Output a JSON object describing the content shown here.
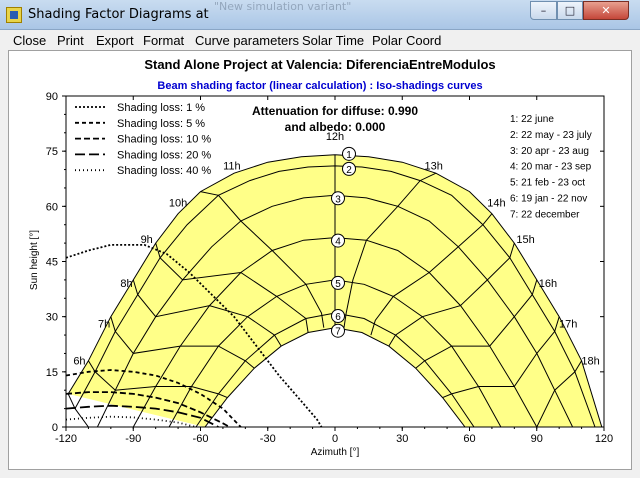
{
  "window": {
    "title": "Shading Factor Diagrams at",
    "background_title": "\"New simulation variant\"",
    "buttons": {
      "minimize": "–",
      "maximize": "□",
      "close": "✕"
    }
  },
  "menu": [
    "Close",
    "Print",
    "Export",
    "Format",
    "Curve parameters",
    "Solar Time",
    "Polar Coord"
  ],
  "colors": {
    "fill": "#ffff88",
    "grid": "#000000",
    "subtitle": "#0000d0"
  },
  "chart_data": {
    "type": "line",
    "title": "Stand Alone Project at Valencia: DiferenciaEntreModulos",
    "subtitle": "Beam shading factor (linear calculation) : Iso-shadings curves",
    "xlabel": "Azimuth [°]",
    "ylabel": "Sun height [°]",
    "xlim": [
      -120,
      120
    ],
    "ylim": [
      0,
      90
    ],
    "xticks": [
      -120,
      -90,
      -60,
      -30,
      0,
      30,
      60,
      90,
      120
    ],
    "yticks": [
      0,
      15,
      30,
      45,
      60,
      75,
      90
    ],
    "attenuation_text": [
      "Attenuation for diffuse: 0.990",
      "and albedo: 0.000"
    ],
    "date_legend": [
      "1: 22 june",
      "2: 22 may - 23 july",
      "3: 20 apr - 23 aug",
      "4: 20 mar - 23 sep",
      "5: 21 feb - 23 oct",
      "6: 19 jan - 22 nov",
      "7: 22 december"
    ],
    "sun_paths": [
      {
        "label": "1",
        "noon_height": 74,
        "points": [
          [
            -119,
            9
          ],
          [
            -110,
            18
          ],
          [
            -100,
            30
          ],
          [
            -90,
            40
          ],
          [
            -80,
            50
          ],
          [
            -70,
            58
          ],
          [
            -60,
            64
          ],
          [
            -45,
            69
          ],
          [
            -30,
            72
          ],
          [
            -15,
            73.5
          ],
          [
            0,
            74
          ],
          [
            15,
            73.5
          ],
          [
            30,
            72
          ],
          [
            45,
            69
          ],
          [
            60,
            64
          ],
          [
            70,
            58
          ],
          [
            80,
            50
          ],
          [
            90,
            40
          ],
          [
            100,
            30
          ],
          [
            110,
            18
          ],
          [
            119,
            0
          ]
        ]
      },
      {
        "label": "2",
        "noon_height": 71,
        "points": [
          [
            -116,
            5
          ],
          [
            -107,
            15
          ],
          [
            -98,
            26
          ],
          [
            -88,
            36
          ],
          [
            -78,
            46
          ],
          [
            -66,
            55
          ],
          [
            -52,
            63
          ],
          [
            -38,
            67
          ],
          [
            -25,
            69.5
          ],
          [
            -12,
            70.7
          ],
          [
            0,
            71
          ],
          [
            12,
            70.7
          ],
          [
            25,
            69.5
          ],
          [
            38,
            67
          ],
          [
            52,
            63
          ],
          [
            66,
            55
          ],
          [
            78,
            46
          ],
          [
            88,
            36
          ],
          [
            98,
            26
          ],
          [
            107,
            15
          ],
          [
            116,
            0
          ]
        ]
      },
      {
        "label": "3",
        "noon_height": 63,
        "points": [
          [
            -106,
            0
          ],
          [
            -98,
            10
          ],
          [
            -90,
            20
          ],
          [
            -80,
            30
          ],
          [
            -68,
            40
          ],
          [
            -55,
            49
          ],
          [
            -42,
            56
          ],
          [
            -28,
            60
          ],
          [
            -14,
            62.3
          ],
          [
            0,
            63
          ],
          [
            14,
            62.3
          ],
          [
            28,
            60
          ],
          [
            42,
            56
          ],
          [
            55,
            49
          ],
          [
            68,
            40
          ],
          [
            80,
            30
          ],
          [
            90,
            20
          ],
          [
            98,
            10
          ],
          [
            106,
            0
          ]
        ]
      },
      {
        "label": "4",
        "noon_height": 51.5,
        "points": [
          [
            -90,
            0
          ],
          [
            -80,
            11
          ],
          [
            -69,
            22
          ],
          [
            -56,
            33
          ],
          [
            -42,
            42
          ],
          [
            -28,
            48
          ],
          [
            -14,
            50.8
          ],
          [
            0,
            51.5
          ],
          [
            14,
            50.8
          ],
          [
            28,
            48
          ],
          [
            42,
            42
          ],
          [
            56,
            33
          ],
          [
            69,
            22
          ],
          [
            80,
            11
          ],
          [
            90,
            0
          ]
        ]
      },
      {
        "label": "5",
        "noon_height": 40,
        "points": [
          [
            -74,
            0
          ],
          [
            -64,
            11
          ],
          [
            -52,
            22
          ],
          [
            -39,
            30
          ],
          [
            -26,
            35.5
          ],
          [
            -13,
            38.8
          ],
          [
            0,
            40
          ],
          [
            13,
            38.8
          ],
          [
            26,
            35.5
          ],
          [
            39,
            30
          ],
          [
            52,
            22
          ],
          [
            64,
            11
          ],
          [
            74,
            0
          ]
        ]
      },
      {
        "label": "6",
        "noon_height": 31,
        "points": [
          [
            -62,
            0
          ],
          [
            -52,
            9
          ],
          [
            -40,
            18
          ],
          [
            -27,
            25
          ],
          [
            -13,
            29.5
          ],
          [
            0,
            31
          ],
          [
            13,
            29.5
          ],
          [
            27,
            25
          ],
          [
            40,
            18
          ],
          [
            52,
            9
          ],
          [
            62,
            0
          ]
        ]
      },
      {
        "label": "7",
        "noon_height": 27,
        "points": [
          [
            -58,
            0
          ],
          [
            -48,
            8
          ],
          [
            -36,
            16
          ],
          [
            -24,
            22
          ],
          [
            -12,
            25.7
          ],
          [
            0,
            27
          ],
          [
            12,
            25.7
          ],
          [
            24,
            22
          ],
          [
            36,
            16
          ],
          [
            48,
            8
          ],
          [
            58,
            0
          ]
        ]
      }
    ],
    "hour_lines": [
      {
        "label": "6h",
        "label_at": [
          -114,
          17
        ],
        "points": [
          [
            -119,
            9
          ],
          [
            -116,
            5
          ],
          [
            -110,
            0
          ]
        ]
      },
      {
        "label": "7h",
        "label_at": [
          -103,
          27
        ],
        "points": [
          [
            -110,
            18
          ],
          [
            -107,
            15
          ],
          [
            -98,
            10
          ],
          [
            -80,
            11
          ],
          [
            -64,
            11
          ],
          [
            -52,
            9
          ],
          [
            -48,
            8
          ]
        ]
      },
      {
        "label": "8h",
        "label_at": [
          -93,
          38
        ],
        "points": [
          [
            -100,
            30
          ],
          [
            -98,
            26
          ],
          [
            -90,
            20
          ],
          [
            -69,
            22
          ],
          [
            -52,
            22
          ],
          [
            -40,
            18
          ],
          [
            -36,
            16
          ]
        ]
      },
      {
        "label": "9h",
        "label_at": [
          -84,
          50
        ],
        "points": [
          [
            -90,
            40
          ],
          [
            -88,
            36
          ],
          [
            -80,
            30
          ],
          [
            -56,
            33
          ],
          [
            -39,
            30
          ],
          [
            -27,
            25
          ],
          [
            -24,
            22
          ]
        ]
      },
      {
        "label": "10h",
        "label_at": [
          -70,
          60
        ],
        "points": [
          [
            -80,
            50
          ],
          [
            -78,
            46
          ],
          [
            -68,
            40
          ],
          [
            -42,
            42
          ],
          [
            -26,
            35.5
          ],
          [
            -13,
            29.5
          ],
          [
            -12,
            25.7
          ]
        ]
      },
      {
        "label": "11h",
        "label_at": [
          -46,
          70
        ],
        "points": [
          [
            -60,
            64
          ],
          [
            -52,
            63
          ],
          [
            -42,
            56
          ],
          [
            -28,
            48
          ],
          [
            -13,
            38.8
          ],
          [
            -6,
            31
          ],
          [
            -5,
            27
          ]
        ]
      },
      {
        "label": "12h",
        "label_at": [
          0,
          78
        ],
        "points": [
          [
            0,
            74
          ],
          [
            0,
            71
          ],
          [
            0,
            63
          ],
          [
            0,
            51.5
          ],
          [
            0,
            40
          ],
          [
            0,
            31
          ],
          [
            0,
            27
          ]
        ]
      },
      {
        "label": "13h",
        "label_at": [
          44,
          70
        ],
        "points": [
          [
            45,
            69
          ],
          [
            38,
            67
          ],
          [
            28,
            60
          ],
          [
            14,
            50.8
          ],
          [
            8,
            40
          ],
          [
            5,
            31
          ],
          [
            4,
            27
          ]
        ]
      },
      {
        "label": "14h",
        "label_at": [
          72,
          60
        ],
        "points": [
          [
            70,
            58
          ],
          [
            66,
            55
          ],
          [
            55,
            49
          ],
          [
            42,
            42
          ],
          [
            26,
            35.5
          ],
          [
            18,
            29
          ],
          [
            16,
            25
          ]
        ]
      },
      {
        "label": "15h",
        "label_at": [
          85,
          50
        ],
        "points": [
          [
            80,
            50
          ],
          [
            78,
            46
          ],
          [
            68,
            40
          ],
          [
            56,
            33
          ],
          [
            39,
            30
          ],
          [
            27,
            25
          ],
          [
            24,
            22
          ]
        ]
      },
      {
        "label": "16h",
        "label_at": [
          95,
          38
        ],
        "points": [
          [
            90,
            40
          ],
          [
            88,
            36
          ],
          [
            80,
            30
          ],
          [
            69,
            22
          ],
          [
            52,
            22
          ],
          [
            40,
            18
          ],
          [
            36,
            16
          ]
        ]
      },
      {
        "label": "17h",
        "label_at": [
          104,
          27
        ],
        "points": [
          [
            100,
            30
          ],
          [
            98,
            26
          ],
          [
            90,
            20
          ],
          [
            80,
            11
          ],
          [
            64,
            11
          ],
          [
            52,
            9
          ],
          [
            48,
            8
          ]
        ]
      },
      {
        "label": "18h",
        "label_at": [
          114,
          17
        ],
        "points": [
          [
            110,
            18
          ],
          [
            107,
            15
          ],
          [
            98,
            10
          ],
          [
            90,
            0
          ],
          [
            74,
            0
          ],
          [
            62,
            0
          ],
          [
            58,
            0
          ]
        ]
      }
    ],
    "shading_curves": [
      {
        "name": "Shading loss: 1 %",
        "dash": "2,2",
        "points": [
          [
            -120,
            46
          ],
          [
            -110,
            48
          ],
          [
            -100,
            49.5
          ],
          [
            -85,
            49.5
          ],
          [
            -75,
            47
          ],
          [
            -65,
            42
          ],
          [
            -55,
            36
          ],
          [
            -45,
            30
          ],
          [
            -35,
            22
          ],
          [
            -25,
            14
          ],
          [
            -15,
            7
          ],
          [
            -8,
            2
          ],
          [
            -6,
            0
          ]
        ]
      },
      {
        "name": "Shading loss: 5 %",
        "dash": "4,3",
        "points": [
          [
            -120,
            14
          ],
          [
            -110,
            15
          ],
          [
            -100,
            15.5
          ],
          [
            -90,
            15
          ],
          [
            -80,
            14
          ],
          [
            -70,
            12
          ],
          [
            -60,
            9
          ],
          [
            -50,
            5
          ],
          [
            -42,
            0
          ]
        ]
      },
      {
        "name": "Shading loss: 10 %",
        "dash": "6,3",
        "points": [
          [
            -120,
            9
          ],
          [
            -110,
            9.5
          ],
          [
            -100,
            9.5
          ],
          [
            -90,
            9
          ],
          [
            -80,
            8
          ],
          [
            -70,
            6.5
          ],
          [
            -60,
            4
          ],
          [
            -50,
            1
          ],
          [
            -47,
            0
          ]
        ]
      },
      {
        "name": "Shading loss: 20 %",
        "dash": "10,4",
        "points": [
          [
            -120,
            5
          ],
          [
            -110,
            5.5
          ],
          [
            -100,
            5.8
          ],
          [
            -90,
            5.5
          ],
          [
            -80,
            5
          ],
          [
            -70,
            4
          ],
          [
            -60,
            2.5
          ],
          [
            -52,
            0
          ]
        ]
      },
      {
        "name": "Shading loss: 40 %",
        "dash": "1,3",
        "points": [
          [
            -120,
            2
          ],
          [
            -110,
            2.5
          ],
          [
            -100,
            2.8
          ],
          [
            -90,
            2.6
          ],
          [
            -80,
            2
          ],
          [
            -70,
            1.2
          ],
          [
            -62,
            0
          ]
        ]
      }
    ]
  }
}
